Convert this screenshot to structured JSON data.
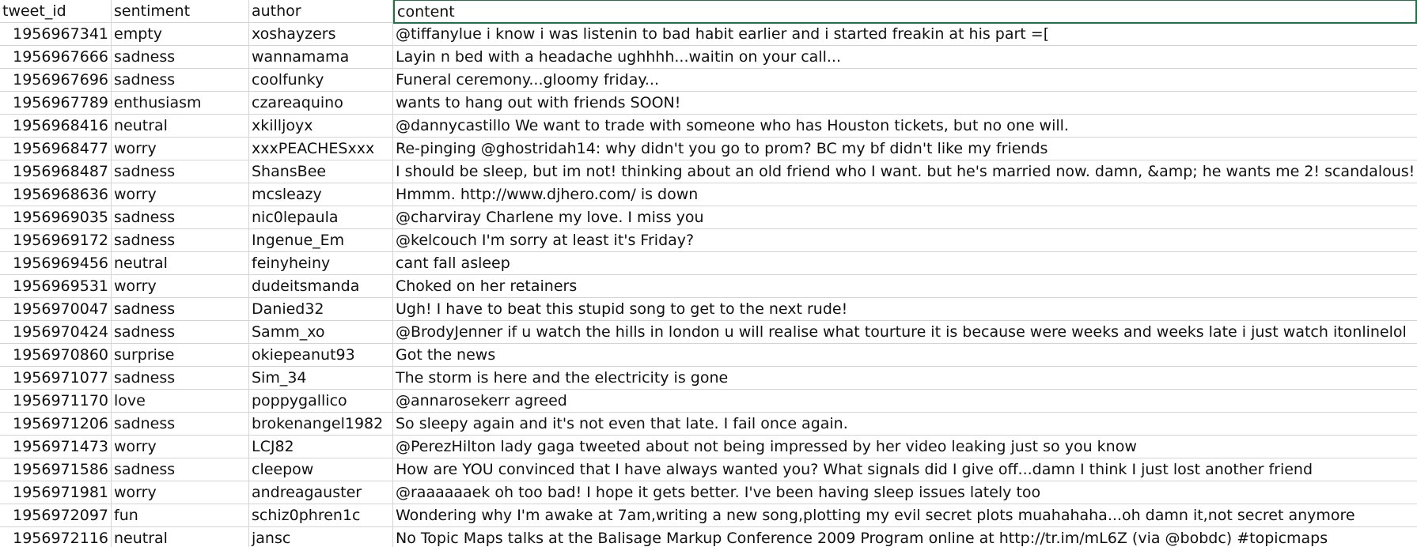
{
  "columns": [
    "tweet_id",
    "sentiment",
    "author",
    "content"
  ],
  "rows": [
    {
      "tweet_id": "1956967341",
      "sentiment": "empty",
      "author": "xoshayzers",
      "content": "@tiffanylue i know  i was listenin to bad habit earlier and i started freakin at his part =["
    },
    {
      "tweet_id": "1956967666",
      "sentiment": "sadness",
      "author": "wannamama",
      "content": "Layin n bed with a headache  ughhhh...waitin on your call..."
    },
    {
      "tweet_id": "1956967696",
      "sentiment": "sadness",
      "author": "coolfunky",
      "content": "Funeral ceremony...gloomy friday..."
    },
    {
      "tweet_id": "1956967789",
      "sentiment": "enthusiasm",
      "author": "czareaquino",
      "content": "wants to hang out with friends SOON!"
    },
    {
      "tweet_id": "1956968416",
      "sentiment": "neutral",
      "author": "xkilljoyx",
      "content": "@dannycastillo We want to trade with someone who has Houston tickets, but no one will."
    },
    {
      "tweet_id": "1956968477",
      "sentiment": "worry",
      "author": "xxxPEACHESxxx",
      "content": "Re-pinging @ghostridah14: why didn't you go to prom? BC my bf didn't like my friends"
    },
    {
      "tweet_id": "1956968487",
      "sentiment": "sadness",
      "author": "ShansBee",
      "content": "I should be sleep, but im not! thinking about an old friend who I want. but he's married now. damn, &amp; he wants me 2! scandalous!"
    },
    {
      "tweet_id": "1956968636",
      "sentiment": "worry",
      "author": "mcsleazy",
      "content": "Hmmm. http://www.djhero.com/ is down"
    },
    {
      "tweet_id": "1956969035",
      "sentiment": "sadness",
      "author": "nic0lepaula",
      "content": "@charviray Charlene my love. I miss you"
    },
    {
      "tweet_id": "1956969172",
      "sentiment": "sadness",
      "author": "Ingenue_Em",
      "content": "@kelcouch I'm sorry  at least it's Friday?"
    },
    {
      "tweet_id": "1956969456",
      "sentiment": "neutral",
      "author": "feinyheiny",
      "content": "cant fall asleep"
    },
    {
      "tweet_id": "1956969531",
      "sentiment": "worry",
      "author": "dudeitsmanda",
      "content": "Choked on her retainers"
    },
    {
      "tweet_id": "1956970047",
      "sentiment": "sadness",
      "author": "Danied32",
      "content": "Ugh! I have to beat this stupid song to get to the next  rude!"
    },
    {
      "tweet_id": "1956970424",
      "sentiment": "sadness",
      "author": "Samm_xo",
      "content": "@BrodyJenner if u watch the hills in london u will realise what tourture it is because were weeks and weeks late  i just watch itonlinelol"
    },
    {
      "tweet_id": "1956970860",
      "sentiment": "surprise",
      "author": "okiepeanut93",
      "content": "Got the news"
    },
    {
      "tweet_id": "1956971077",
      "sentiment": "sadness",
      "author": "Sim_34",
      "content": "The storm is here and the electricity is gone"
    },
    {
      "tweet_id": "1956971170",
      "sentiment": "love",
      "author": "poppygallico",
      "content": "@annarosekerr agreed"
    },
    {
      "tweet_id": "1956971206",
      "sentiment": "sadness",
      "author": "brokenangel1982",
      "content": "So sleepy again and it's not even that late. I fail once again."
    },
    {
      "tweet_id": "1956971473",
      "sentiment": "worry",
      "author": "LCJ82",
      "content": "@PerezHilton lady gaga tweeted about not being impressed by her video leaking just so you know"
    },
    {
      "tweet_id": "1956971586",
      "sentiment": "sadness",
      "author": "cleepow",
      "content": "How are YOU convinced that I have always wanted you? What signals did I give off...damn I think I just lost another friend"
    },
    {
      "tweet_id": "1956971981",
      "sentiment": "worry",
      "author": "andreagauster",
      "content": "@raaaaaaek oh too bad! I hope it gets better. I've been having sleep issues lately too"
    },
    {
      "tweet_id": "1956972097",
      "sentiment": "fun",
      "author": "schiz0phren1c",
      "content": "Wondering why I'm awake at 7am,writing a new song,plotting my evil secret plots muahahaha...oh damn it,not secret anymore"
    },
    {
      "tweet_id": "1956972116",
      "sentiment": "neutral",
      "author": "jansc",
      "content": "No Topic Maps talks at the Balisage Markup Conference 2009   Program online at http://tr.im/mL6Z (via @bobdc) #topicmaps"
    }
  ]
}
